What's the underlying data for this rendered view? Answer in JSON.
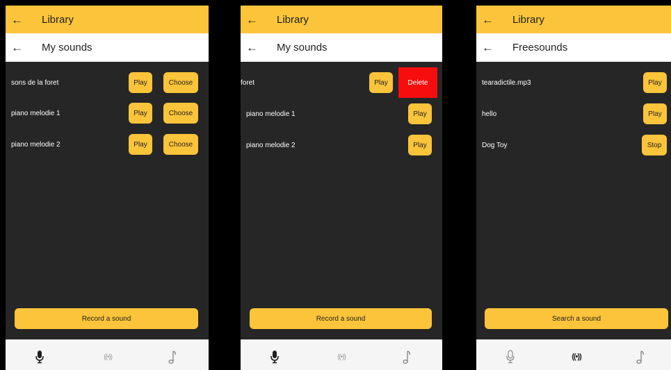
{
  "screens": [
    {
      "header": {
        "title": "Library",
        "back_icon": "←"
      },
      "subheader": {
        "title": "My sounds",
        "back_icon": "←"
      },
      "rows": [
        {
          "label": "sons de la foret",
          "play": "Play",
          "choose": "Choose"
        },
        {
          "label": "piano melodie 1",
          "play": "Play",
          "choose": "Choose"
        },
        {
          "label": "piano melodie 2",
          "play": "Play",
          "choose": "Choose"
        }
      ],
      "bottom_button": "Record a sound",
      "nav": {
        "waves_glyph": "((•))",
        "active": "microphone"
      }
    },
    {
      "header": {
        "title": "Library",
        "back_icon": "←"
      },
      "subheader": {
        "title": "My sounds",
        "back_icon": "←"
      },
      "rows": [
        {
          "label": "foret",
          "play": "Play",
          "delete": "Delete"
        },
        {
          "label": "piano melodie 1",
          "play": "Play"
        },
        {
          "label": "piano melodie 2",
          "play": "Play"
        }
      ],
      "bottom_button": "Record a sound",
      "nav": {
        "waves_glyph": "((•))",
        "active": "microphone"
      }
    },
    {
      "header": {
        "title": "Library",
        "back_icon": "←"
      },
      "subheader": {
        "title": "Freesounds",
        "back_icon": "←"
      },
      "rows": [
        {
          "label": "tearadictile.mp3",
          "play": "Play"
        },
        {
          "label": "hello",
          "play": "Play"
        },
        {
          "label": "Dog Toy",
          "play": "Stop"
        }
      ],
      "bottom_button": "Search a sound",
      "nav": {
        "waves_glyph": "((•))",
        "active": "waves"
      }
    }
  ],
  "colors": {
    "accent": "#fbc43a",
    "background": "#262626",
    "delete": "#f70d0d",
    "navbar": "#f5f5f5"
  }
}
